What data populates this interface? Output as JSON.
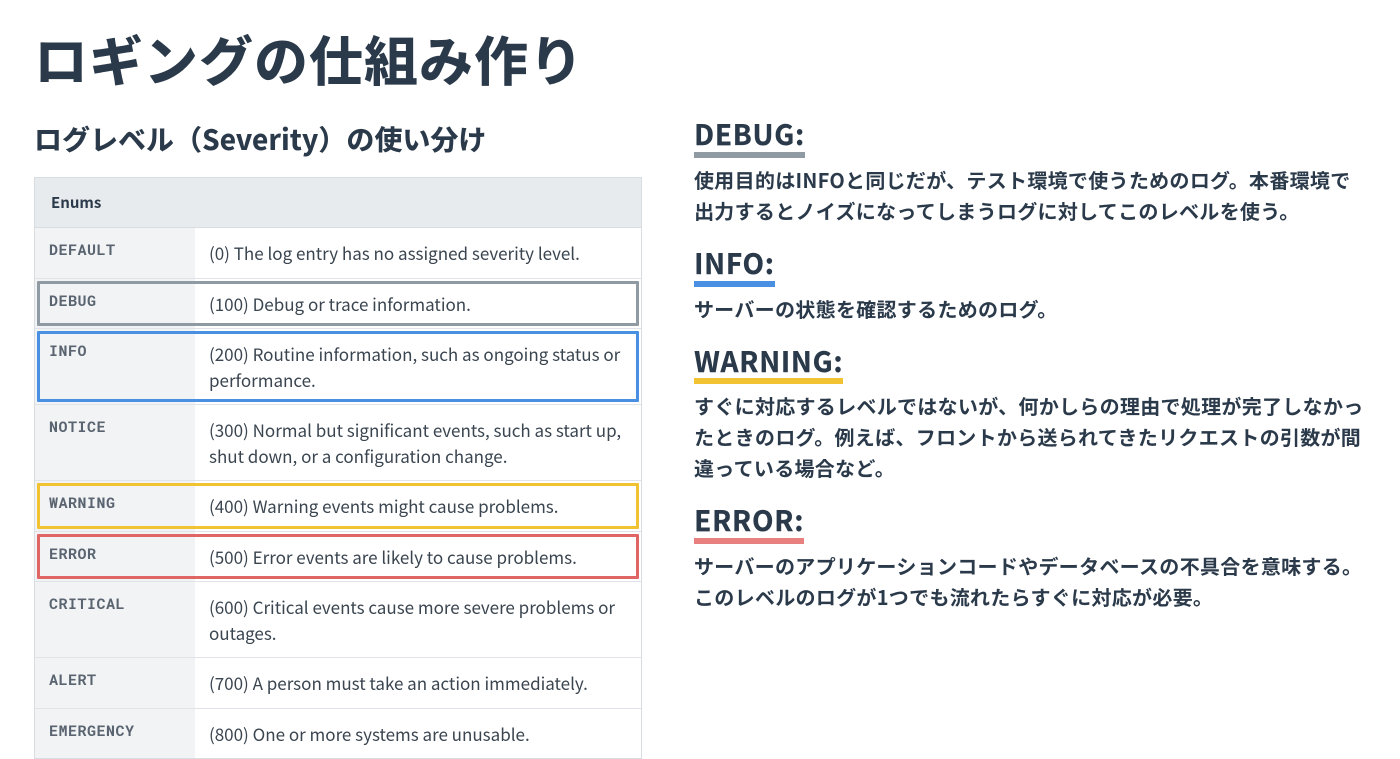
{
  "title": "ロギングの仕組み作り",
  "subhead": "ログレベル（Severity）の使い分け",
  "table": {
    "header": "Enums",
    "rows": [
      {
        "name": "DEFAULT",
        "desc": "(0) The log entry has no assigned severity level.",
        "hl": ""
      },
      {
        "name": "DEBUG",
        "desc": "(100) Debug or trace information.",
        "hl": "gray"
      },
      {
        "name": "INFO",
        "desc": "(200) Routine information, such as ongoing status or performance.",
        "hl": "blue"
      },
      {
        "name": "NOTICE",
        "desc": "(300) Normal but significant events, such as start up, shut down, or a configuration change.",
        "hl": ""
      },
      {
        "name": "WARNING",
        "desc": "(400) Warning events might cause problems.",
        "hl": "yellow"
      },
      {
        "name": "ERROR",
        "desc": "(500) Error events are likely to cause problems.",
        "hl": "red"
      },
      {
        "name": "CRITICAL",
        "desc": "(600) Critical events cause more severe problems or outages.",
        "hl": ""
      },
      {
        "name": "ALERT",
        "desc": "(700) A person must take an action immediately.",
        "hl": ""
      },
      {
        "name": "EMERGENCY",
        "desc": "(800) One or more systems are unusable.",
        "hl": ""
      }
    ]
  },
  "sections": [
    {
      "title": "DEBUG:",
      "underline": "gray",
      "body": "使用目的はINFOと同じだが、テスト環境で使うためのログ。本番環境で出力するとノイズになってしまうログに対してこのレベルを使う。"
    },
    {
      "title": "INFO:",
      "underline": "blue",
      "body": "サーバーの状態を確認するためのログ。"
    },
    {
      "title": "WARNING:",
      "underline": "yellow",
      "body": "すぐに対応するレベルではないが、何かしらの理由で処理が完了しなかったときのログ。例えば、フロントから送られてきたリクエストの引数が間違っている場合など。"
    },
    {
      "title": "ERROR:",
      "underline": "red",
      "body": "サーバーのアプリケーションコードやデータベースの不具合を意味する。 このレベルのログが1つでも流れたらすぐに対応が必要。"
    }
  ]
}
